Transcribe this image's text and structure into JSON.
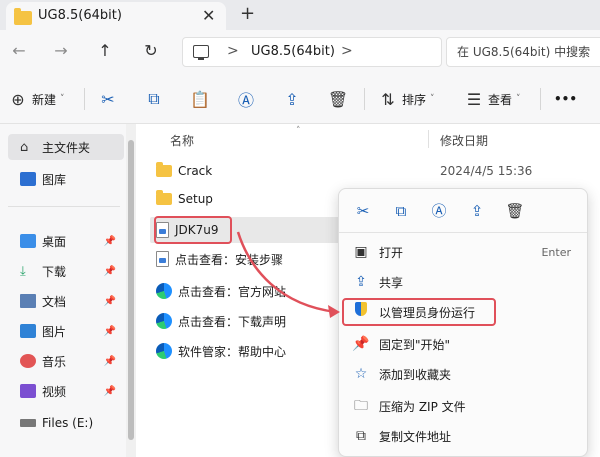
{
  "tab": {
    "title": "UG8.5(64bit)",
    "close": "✕",
    "new": "+"
  },
  "nav": {
    "back": "←",
    "forward": "→",
    "up": "↑",
    "refresh": "↻"
  },
  "address": {
    "crumb": "UG8.5(64bit)",
    "sep": ">"
  },
  "search": {
    "placeholder": "在 UG8.5(64bit) 中搜索"
  },
  "command": {
    "new_label": "新建",
    "sort_label": "排序",
    "view_label": "查看",
    "more": "•••"
  },
  "sidebar": {
    "home": "主文件夹",
    "gallery": "图库",
    "items": [
      {
        "label": "桌面"
      },
      {
        "label": "下载"
      },
      {
        "label": "文档"
      },
      {
        "label": "图片"
      },
      {
        "label": "音乐"
      },
      {
        "label": "视频"
      },
      {
        "label": "Files (E:)"
      }
    ]
  },
  "columns": {
    "name": "名称",
    "date": "修改日期"
  },
  "files": [
    {
      "name": "Crack",
      "date": "2024/4/5 15:36",
      "kind": "folder"
    },
    {
      "name": "Setup",
      "date": "",
      "kind": "folder"
    },
    {
      "name": "JDK7u9",
      "date": "",
      "kind": "exe"
    },
    {
      "name": "点击查看：安装步骤",
      "date": "",
      "kind": "file"
    },
    {
      "name": "点击查看：官方网站",
      "date": "",
      "kind": "edge"
    },
    {
      "name": "点击查看：下载声明",
      "date": "",
      "kind": "edge"
    },
    {
      "name": "软件管家：帮助中心",
      "date": "",
      "kind": "edge"
    }
  ],
  "context_menu": {
    "items": [
      {
        "label": "打开",
        "shortcut": "Enter"
      },
      {
        "label": "共享",
        "shortcut": ""
      },
      {
        "label": "以管理员身份运行",
        "shortcut": ""
      },
      {
        "label": "固定到\"开始\"",
        "shortcut": ""
      },
      {
        "label": "添加到收藏夹",
        "shortcut": ""
      },
      {
        "label": "压缩为 ZIP 文件",
        "shortcut": ""
      },
      {
        "label": "复制文件地址",
        "shortcut": ""
      }
    ]
  },
  "colors": {
    "accent": "#1a5fb4",
    "highlight": "#e0505a",
    "folder": "#f5c343"
  }
}
